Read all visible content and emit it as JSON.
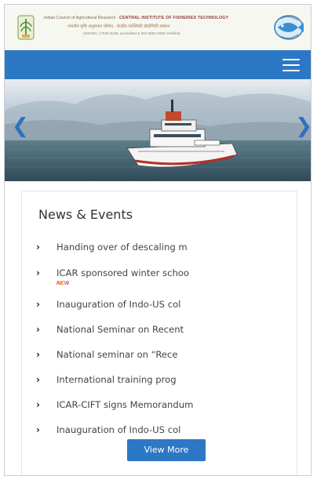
{
  "header": {
    "org_line": "Indian Council of Agricultural Research -",
    "institute_name": "CENTRAL INSTITUTE OF FISHERIES TECHNOLOGY",
    "hindi_line": "भारतीय कृषि अनुसंधान परिषद - केन्द्रीय मात्स्यिकी प्रौद्योगिकी संस्थान",
    "accreditation": "(ISO/IEC 17025 NABL accredited & ISO 9001:2008 certified)"
  },
  "slider": {
    "prev_icon": "chevron-left-icon",
    "next_icon": "chevron-right-icon"
  },
  "news": {
    "title": "News & Events",
    "items": [
      {
        "label": "Handing over of descaling m"
      },
      {
        "label": "ICAR sponsored winter schoo",
        "badge": "NEW"
      },
      {
        "label": "Inauguration of Indo-US col"
      },
      {
        "label": "National Seminar on Recent"
      },
      {
        "label": "National seminar on “Rece"
      },
      {
        "label": "International training prog"
      },
      {
        "label": "ICAR-CIFT signs Memorandum"
      },
      {
        "label": "Inauguration of Indo-US col"
      }
    ],
    "view_more": "View More"
  },
  "colors": {
    "primary": "#2c78c5",
    "header_bg": "#f7f7f2"
  }
}
